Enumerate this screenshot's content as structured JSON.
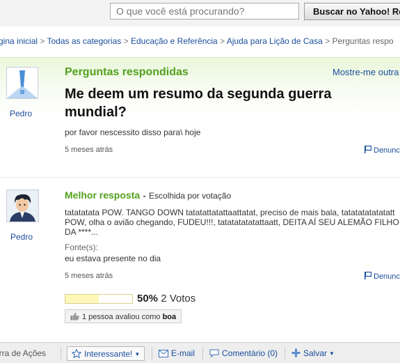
{
  "search": {
    "placeholder": "O que você está procurando?",
    "button_label": "Buscar no Yahoo! Re"
  },
  "breadcrumb": {
    "items": [
      "gina inicial",
      "Todas as categorias",
      "Educação e Referência",
      "Ajuda para Lição de Casa"
    ],
    "current": "Perguntas respo",
    "separator": ">"
  },
  "question": {
    "section_label": "Perguntas respondidas",
    "show_other_link": "Mostre-me outra",
    "asker_name": "Pedro",
    "title": "Me deem um resumo da segunda guerra mundial?",
    "body": "por favor nescessito disso para\\ hoje",
    "time_ago": "5 meses atrás",
    "report_label": "Denunc"
  },
  "best_answer": {
    "label": "Melhor resposta",
    "dash": "-",
    "chosen_text": "Escolhida por votação",
    "answerer_name": "Pedro",
    "body": "tatatatata POW. TANGO DOWN tatatattatattaattatat, preciso de mais bala, tatatatatatatatt POW, olha o avião chegando, FUDEU!!!, tatatatatatattaatt, DEITA AÍ SEU ALEMÃO FILHO DA ****...",
    "sources_label": "Fonte(s):",
    "sources_value": "eu estava presente no dia",
    "time_ago": "5 meses atrás",
    "report_label": "Denunc",
    "rating_percent_text": "50%",
    "rating_fraction": 0.5,
    "votes_text": "2 Votos",
    "rated_prefix": "1 pessoa avaliou como",
    "rated_value": "boa"
  },
  "actions": {
    "toolbar_label": "arra de Ações",
    "interesting": "Interessante!",
    "email": "E-mail",
    "comments": "Comentário (0)",
    "save": "Salvar"
  },
  "colors": {
    "accent_green": "#53a11f",
    "link_blue": "#1a4d9c",
    "rating_fill": "#fdf7b8"
  },
  "icons": [
    "question-avatar-icon",
    "user-avatar-icon",
    "flag-icon",
    "thumbs-up-icon",
    "star-icon",
    "envelope-icon",
    "comment-icon",
    "plus-icon",
    "caret-down-icon"
  ]
}
